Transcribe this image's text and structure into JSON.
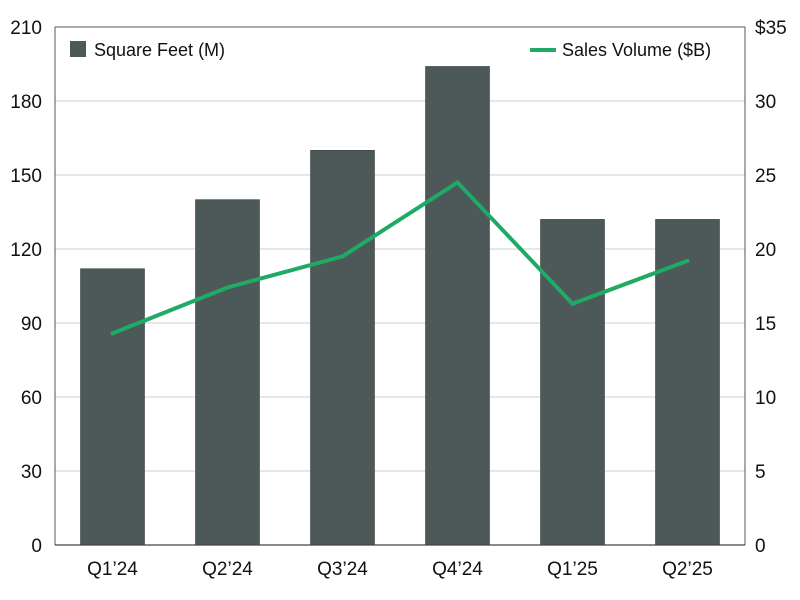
{
  "chart_data": {
    "type": "bar+line",
    "categories": [
      "Q1’24",
      "Q2’24",
      "Q3’24",
      "Q4’24",
      "Q1’25",
      "Q2’25"
    ],
    "series": [
      {
        "name": "Square Feet (M)",
        "type": "bar",
        "axis": "left",
        "values": [
          112,
          140,
          160,
          194,
          132,
          132
        ],
        "color": "#4d5859"
      },
      {
        "name": "Sales Volume ($B)",
        "type": "line",
        "axis": "right",
        "values": [
          14.3,
          17.4,
          19.5,
          24.5,
          16.3,
          19.2
        ],
        "color": "#1faa66"
      }
    ],
    "left_axis": {
      "ticks": [
        "0",
        "30",
        "60",
        "90",
        "120",
        "150",
        "180",
        "210"
      ],
      "ylim": [
        0,
        210
      ]
    },
    "right_axis": {
      "ticks": [
        "0",
        "5",
        "10",
        "15",
        "20",
        "25",
        "30",
        "$35"
      ],
      "ylim": [
        0,
        35
      ]
    },
    "grid": true,
    "legend": [
      "top-left",
      "top-right"
    ]
  }
}
